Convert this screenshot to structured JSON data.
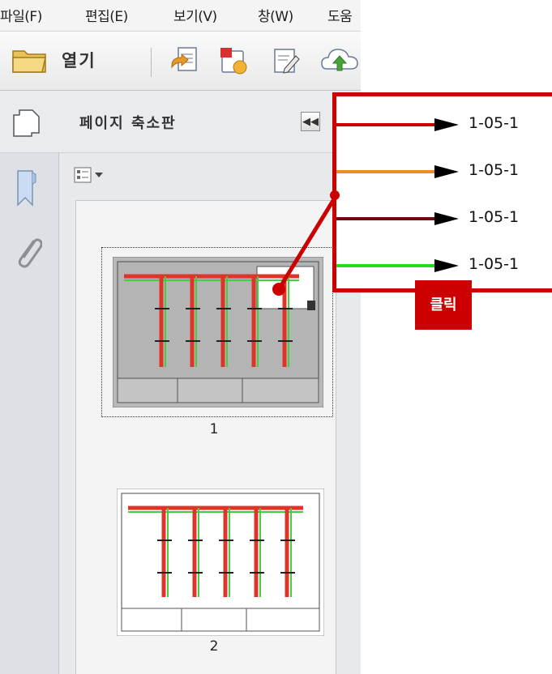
{
  "menu": {
    "items": [
      "파일(F)",
      "편집(E)",
      "보기(V)",
      "창(W)",
      "도움"
    ]
  },
  "toolbar": {
    "open_label": "열기",
    "icons": [
      "folder-icon",
      "convert-icon",
      "create-pdf-icon",
      "sign-icon",
      "cloud-upload-icon"
    ]
  },
  "panel": {
    "title": "페이지 축소판",
    "collapse_glyph": "◀◀"
  },
  "thumbnails": {
    "pages": [
      "1",
      "2"
    ],
    "selected_page": "1"
  },
  "callout": {
    "references": [
      {
        "text": "1-05-1",
        "line_color": "#cc0000"
      },
      {
        "text": "1-05-1",
        "line_color": "#ee8a2a"
      },
      {
        "text": "1-05-1",
        "line_color": "#6b0a10"
      },
      {
        "text": "1-05-1",
        "line_color": "#22dd22"
      }
    ],
    "click_label": "클릭",
    "accent": "#cc0000"
  }
}
